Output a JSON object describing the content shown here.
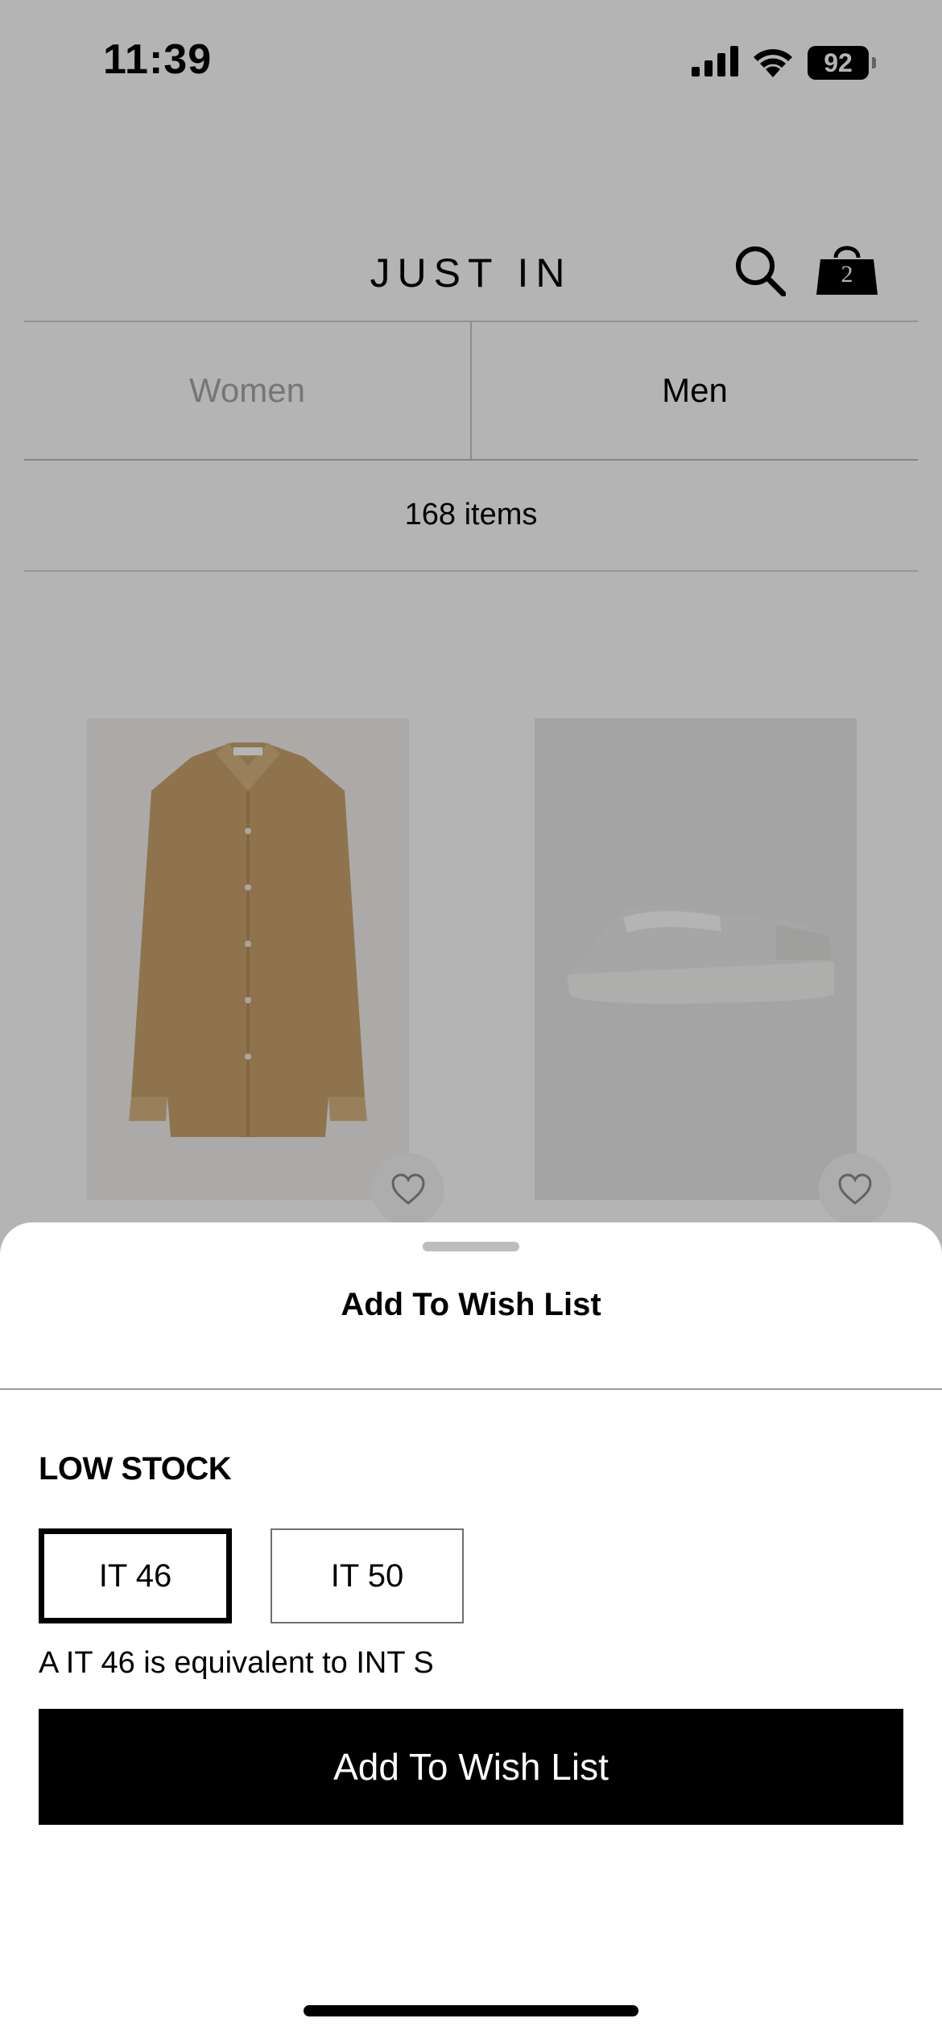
{
  "status_bar": {
    "time": "11:39",
    "battery": "92"
  },
  "header": {
    "title": "JUST IN",
    "search_icon": "search-icon",
    "bag_icon": "shopping-bag-icon",
    "bag_count": "2"
  },
  "tabs": [
    {
      "label": "Women",
      "selected": false
    },
    {
      "label": "Men",
      "selected": true
    }
  ],
  "item_count": "168 items",
  "products": [
    {
      "image": "corduroy-shirt-image",
      "wish_icon": "heart-icon"
    },
    {
      "image": "white-sneaker-image",
      "wish_icon": "heart-icon"
    }
  ],
  "sheet": {
    "title": "Add To Wish List",
    "stock_label": "LOW STOCK",
    "sizes": [
      {
        "label": "IT 46",
        "selected": true
      },
      {
        "label": "IT 50",
        "selected": false
      }
    ],
    "size_note": "A IT 46 is equivalent to INT S",
    "cta_label": "Add To Wish List"
  },
  "colors": {
    "overlay": "#000000",
    "accent": "#000000",
    "muted_tab": "#a8a8a8"
  }
}
